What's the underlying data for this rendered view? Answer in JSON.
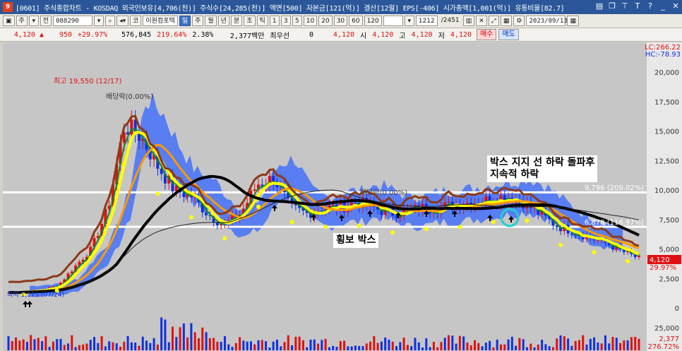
{
  "window": {
    "icon_label": "9",
    "title": "[0601] 주식종합차트 - KOSDAQ 외국인보유[4,706(천)] 주식수[24,285(천)] 액면[500] 자본금[121(억)] 결산[12월] EPS[-406] 시가총액[1,001(억)] 유통비율[82.7]"
  },
  "toolbar": {
    "btn_ju": "주",
    "btn_jeon": "전",
    "code": "088290",
    "btn_ko": "코",
    "stock_name": "이원컴포텍",
    "periods": [
      "일",
      "주",
      "월",
      "년",
      "분",
      "초",
      "틱"
    ],
    "minutes": [
      "1",
      "3",
      "5",
      "10",
      "20",
      "30",
      "60",
      "120"
    ],
    "count": "1212",
    "total": "/2451",
    "date": "2023/09/13"
  },
  "quote": {
    "price": "4,120",
    "change": "950",
    "change_pct": "+29.97%",
    "volume": "576,845",
    "volume_ratio": "219.64%",
    "turnover": "2.38%",
    "amount": "2,377백만",
    "priority_label": "최우선",
    "priority_value": "0",
    "priority_price": "4,120",
    "open_label": "시",
    "open": "4,120",
    "high_label": "고",
    "high": "4,120",
    "low_label": "저",
    "low": "4,120",
    "buy_label": "매수",
    "sell_label": "매도"
  },
  "chart_data": {
    "type": "candlestick",
    "y_ticks": [
      "20,000",
      "17,500",
      "15,000",
      "12,500",
      "10,000",
      "7,500",
      "5,000",
      "2,500",
      "0"
    ],
    "volume_ticks": [
      "25,000",
      "2,377",
      "276.72%"
    ],
    "lc_label": "LC:266.22",
    "hc_label": "HC:-78.93",
    "high_marker": "최고 19,550 (12/17)",
    "dividend_labels": [
      "배당락(0.00%)",
      "배당락(0.00%)"
    ],
    "line_labels": [
      "9,796 (209.02%)",
      "6,878 (116.97%)"
    ],
    "last_price_tag": "4,120",
    "last_change_tag": "29.97%",
    "low_marker": "최저 1,115 (07/24)",
    "horizontal_lines": [
      9796,
      6878
    ],
    "price_samples": [
      1.3,
      1.4,
      1.5,
      1.9,
      3.5,
      5.0,
      8.5,
      15.5,
      14.5,
      12.0,
      10.0,
      9.5,
      8.0,
      7.0,
      8.0,
      10.5,
      11.0,
      8.5,
      8.0,
      8.5,
      8.5,
      9.0,
      8.5,
      8.0,
      8.2,
      8.5,
      8.5,
      8.8,
      9.0,
      9.2,
      9.5,
      9.0,
      8.0,
      7.0,
      6.5,
      6.0,
      5.5,
      4.8,
      4.2
    ],
    "colors": {
      "upper_line": "#ffffff",
      "cloud": "#3366ff",
      "ma_long": "#000000",
      "ma_brown": "#8b3a1a",
      "ma_yellow": "#ffff00",
      "ma_orange": "#ff9900",
      "ma_green": "#118822"
    }
  },
  "annotations": {
    "breakdown": "박스 지지 선 하락 돌파후\n지속적 하락",
    "sideways_box": "횡보 박스"
  }
}
